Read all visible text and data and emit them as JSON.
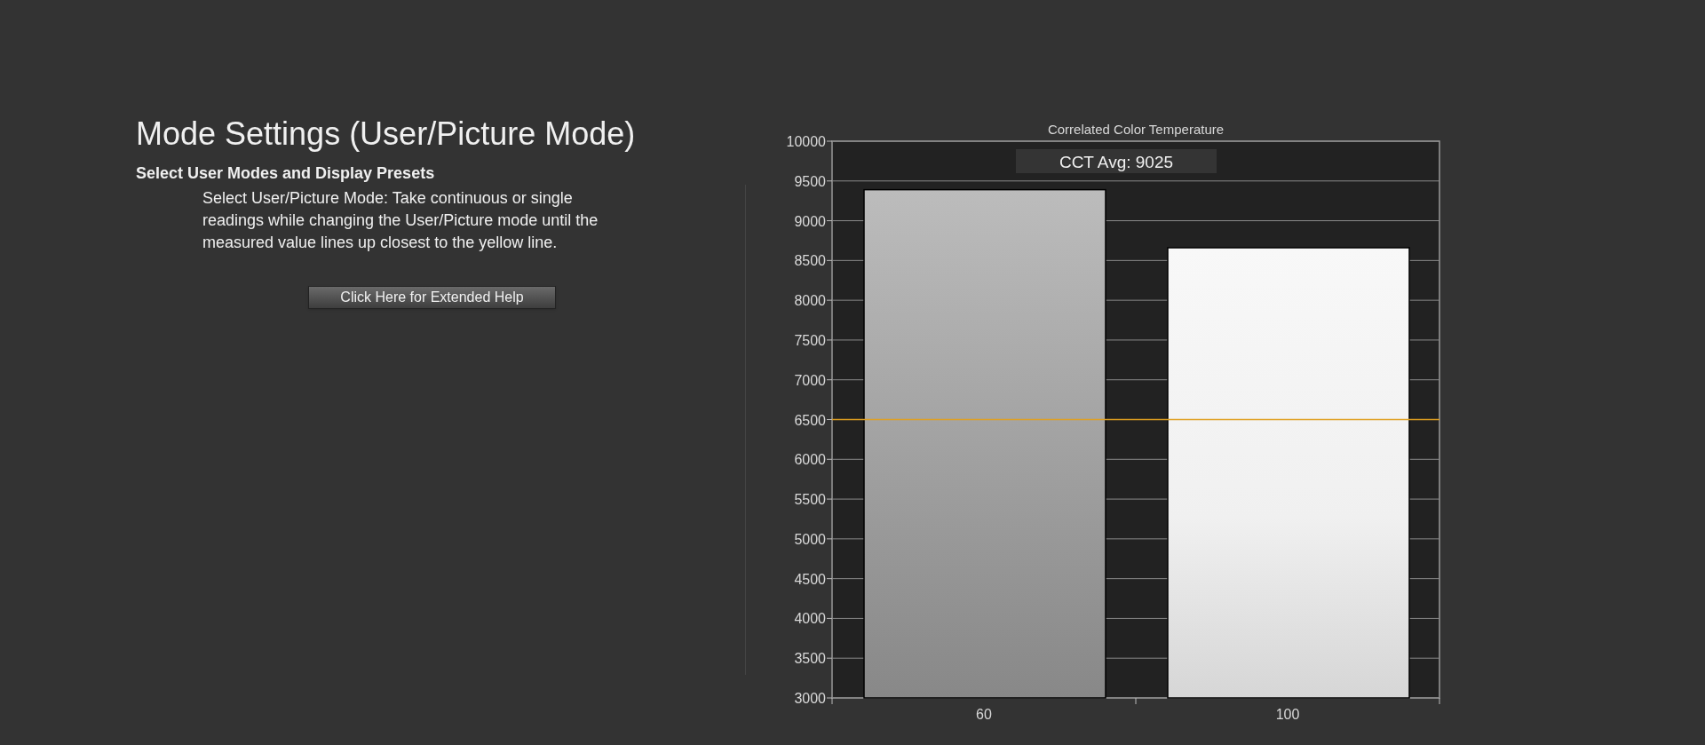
{
  "title": "Mode Settings (User/Picture Mode)",
  "subtitle": "Select User Modes and Display Presets",
  "description": "Select User/Picture Mode: Take continuous or single readings while changing the User/Picture mode until the measured value lines up closest to the yellow line.",
  "help_button": "Click Here for Extended Help",
  "chart": {
    "chart_data": {
      "type": "bar",
      "title": "Correlated Color Temperature",
      "categories": [
        "60",
        "100"
      ],
      "values": [
        9390,
        8660
      ],
      "ylim": [
        3000,
        10000
      ],
      "yticks": [
        3000,
        3500,
        4000,
        4500,
        5000,
        5500,
        6000,
        6500,
        7000,
        7500,
        8000,
        8500,
        9000,
        9500,
        10000
      ],
      "grid": true,
      "annotations": [
        {
          "text": "CCT Avg: 9025"
        }
      ],
      "ref_lines": [
        {
          "axis": "y",
          "value": 6500,
          "color": "#e0a020"
        }
      ]
    }
  }
}
